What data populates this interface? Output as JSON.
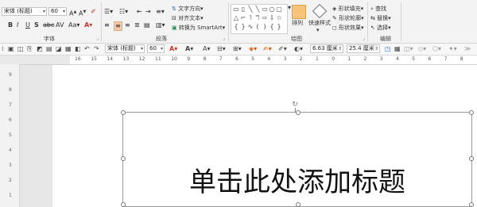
{
  "font": {
    "name": "宋体 (标题)",
    "size": "60",
    "group_label": "字体"
  },
  "paragraph": {
    "text_direction": "文字方向",
    "align_text": "对齐文本",
    "smartart": "转换为 SmartArt",
    "group_label": "段落"
  },
  "drawing": {
    "arrange": "排列",
    "quick_styles": "快速样式",
    "shape_fill": "形状填充",
    "shape_outline": "形状轮廓",
    "shape_effects": "形状效果",
    "group_label": "绘图"
  },
  "editing": {
    "find": "查找",
    "replace": "替换",
    "select": "选择",
    "group_label": "编辑"
  },
  "toolbar": {
    "font_name": "宋体 (标题)",
    "font_size": "60",
    "width": "6.63 厘米",
    "height": "25.4 厘米"
  },
  "ruler": {
    "labels": [
      "16",
      "15",
      "14",
      "13",
      "12",
      "11",
      "10",
      "9",
      "8",
      "7",
      "6",
      "5",
      "4",
      "3",
      "2",
      "1",
      "0",
      "1",
      "2",
      "3",
      "4",
      "5",
      "6",
      "7",
      "8"
    ]
  },
  "vruler": {
    "labels": [
      "9",
      "8",
      "7",
      "6",
      "5",
      "4",
      "3",
      "2",
      "1"
    ]
  },
  "slide": {
    "title": "单击此处添加标题"
  },
  "colors": {
    "accent": "#c0392b",
    "ribbon_bg": "#f3f3f3"
  }
}
